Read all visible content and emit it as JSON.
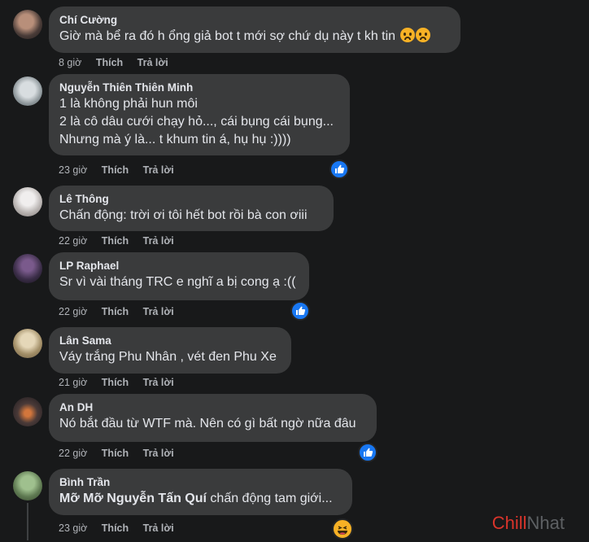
{
  "comments": [
    {
      "author": "Chí Cường",
      "text": "Giờ mà bể ra đó h ổng giả bot t mới sợ chứ dụ này t kh tin",
      "time": "8 giờ",
      "like": "Thích",
      "reply": "Trả lời",
      "emojis": [
        "sad",
        "sad"
      ]
    },
    {
      "author": "Nguyễn Thiên Thiên Minh",
      "lines": [
        "1 là không phải hun môi",
        "2 là cô dâu cưới chạy hỏ..., cái bụng cái bụng...",
        "Nhưng mà ý là... t khum tin á, hụ hụ :))))"
      ],
      "time": "23 giờ",
      "like": "Thích",
      "reply": "Trả lời",
      "reaction": "like"
    },
    {
      "author": "Lê Thông",
      "text": "Chấn động: trời ơi tôi hết bot rồi bà con ơiii",
      "time": "22 giờ",
      "like": "Thích",
      "reply": "Trả lời"
    },
    {
      "author": "LP Raphael",
      "text": "Sr vì vài tháng TRC e nghĩ a bị cong ạ :((",
      "time": "22 giờ",
      "like": "Thích",
      "reply": "Trả lời",
      "reaction": "like"
    },
    {
      "author": "Lân Sama",
      "text": "Váy trắng Phu Nhân , vét đen Phu Xe",
      "time": "21 giờ",
      "like": "Thích",
      "reply": "Trả lời"
    },
    {
      "author": "An DH",
      "text": "Nó bắt đầu từ WTF mà. Nên có gì bất ngờ nữa đâu",
      "time": "22 giờ",
      "like": "Thích",
      "reply": "Trả lời",
      "reaction": "like"
    },
    {
      "author": "Bình Trần",
      "mention": "Mỡ Mỡ Nguyễn Tấn Quí",
      "text": " chấn động tam giới...",
      "time": "23 giờ",
      "like": "Thích",
      "reply": "Trả lời",
      "reaction": "haha"
    }
  ],
  "watermark": {
    "part1": "Chill",
    "part2": "Nhat"
  },
  "colors": {
    "background": "#18191a",
    "bubble": "#3a3b3c",
    "like_blue": "#1877f2",
    "watermark_red": "#d9342b"
  }
}
